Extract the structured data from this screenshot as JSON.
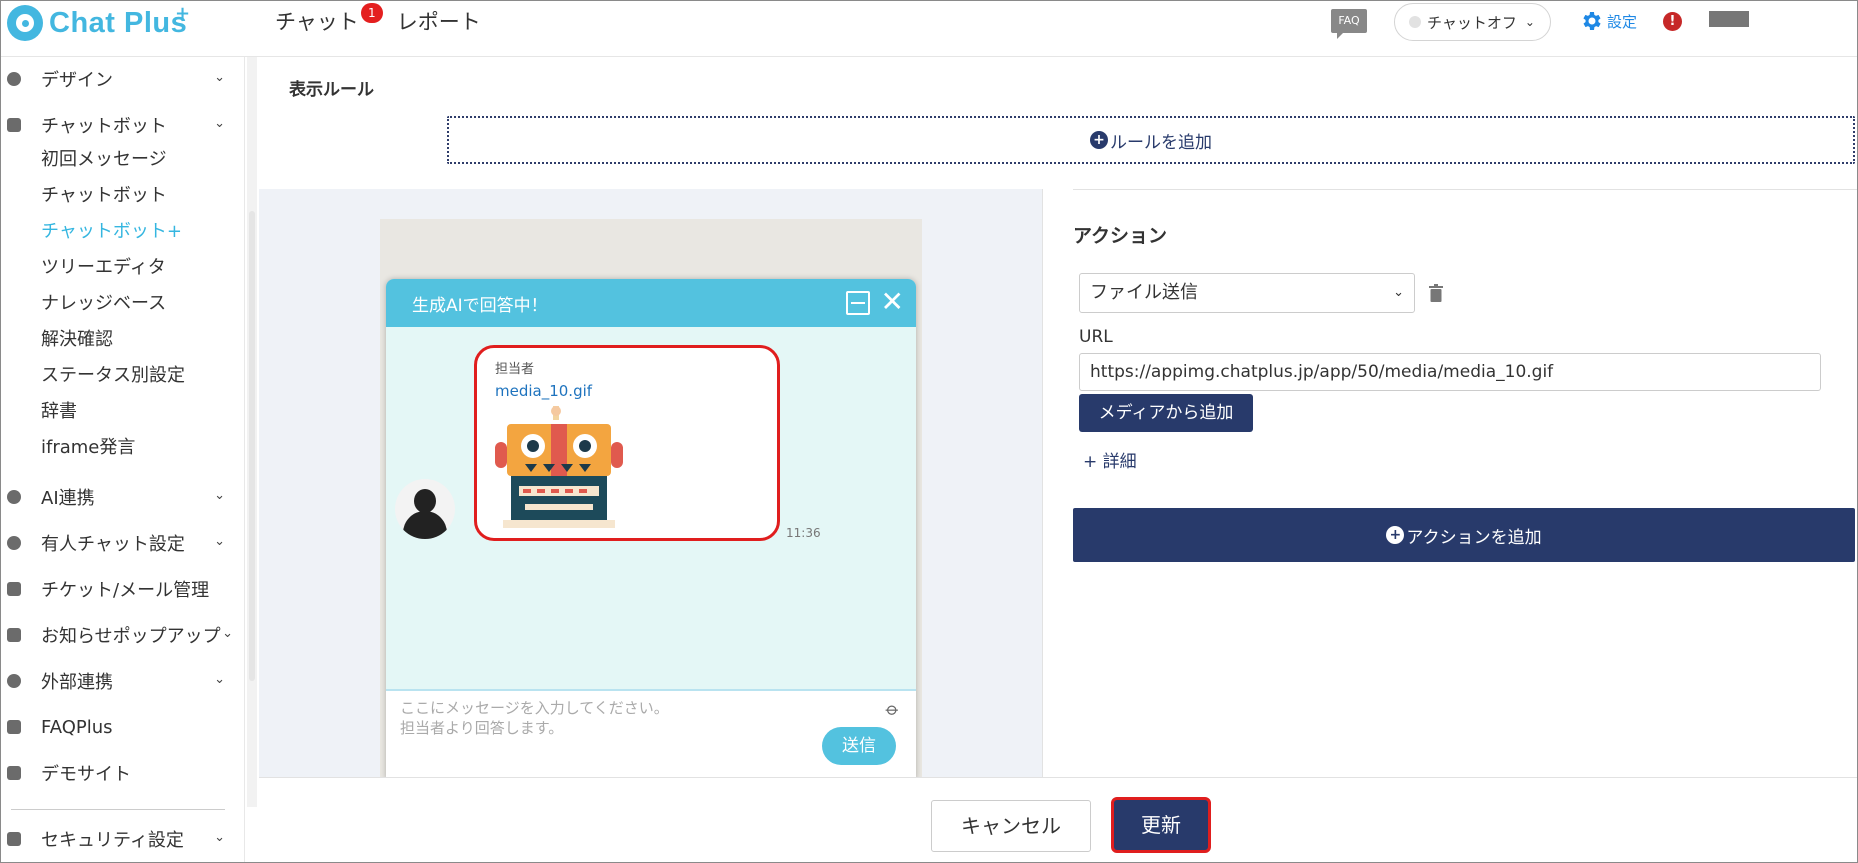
{
  "header": {
    "logo_text": "Chat Plus",
    "logo_plus": "+",
    "nav": [
      {
        "label": "チャット",
        "badge": "1"
      },
      {
        "label": "レポート"
      }
    ],
    "faq_icon_text": "FAQ",
    "status_label": "チャットオフ",
    "settings_label": "設定",
    "alert_mark": "!"
  },
  "sidebar": {
    "items": [
      {
        "label": "デザイン",
        "icon": "palette-icon"
      },
      {
        "label": "チャットボット",
        "icon": "chat-icon"
      },
      {
        "label": "AI連携",
        "icon": "bulb-icon"
      },
      {
        "label": "有人チャット設定",
        "icon": "headset-icon"
      },
      {
        "label": "チケット/メール管理",
        "icon": "ticket-icon"
      },
      {
        "label": "お知らせポップアップ",
        "icon": "popup-icon"
      },
      {
        "label": "外部連携",
        "icon": "share-icon"
      },
      {
        "label": "FAQPlus",
        "icon": "shield-icon"
      },
      {
        "label": "デモサイト",
        "icon": "monitor-icon"
      },
      {
        "label": "セキュリティ設定",
        "icon": "lock-icon"
      }
    ],
    "chatbot_sub": [
      "初回メッセージ",
      "チャットボット",
      "チャットボット+",
      "ツリーエディタ",
      "ナレッジベース",
      "解決確認",
      "ステータス別設定",
      "辞書",
      "iframe発言"
    ]
  },
  "main": {
    "display_rule_title": "表示ルール",
    "add_rule_label": "ルールを追加",
    "preview": {
      "chat_title": "生成AIで回答中！",
      "sender": "担当者",
      "file_name": "media_10.gif",
      "time": "11:36",
      "placeholder_line1": "ここにメッセージを入力してください。",
      "placeholder_line2": "担当者より回答します。",
      "send_label": "送信"
    },
    "action": {
      "title": "アクション",
      "select_value": "ファイル送信",
      "url_label": "URL",
      "url_value": "https://appimg.chatplus.jp/app/50/media/media_10.gif",
      "media_button": "メディアから追加",
      "detail_link": "+ 詳細",
      "add_action_label": "アクションを追加"
    }
  },
  "footer": {
    "cancel_label": "キャンセル",
    "update_label": "更新"
  },
  "colors": {
    "brand": "#43b7e0",
    "navy": "#283a6b",
    "highlight": "#e01e1e"
  }
}
